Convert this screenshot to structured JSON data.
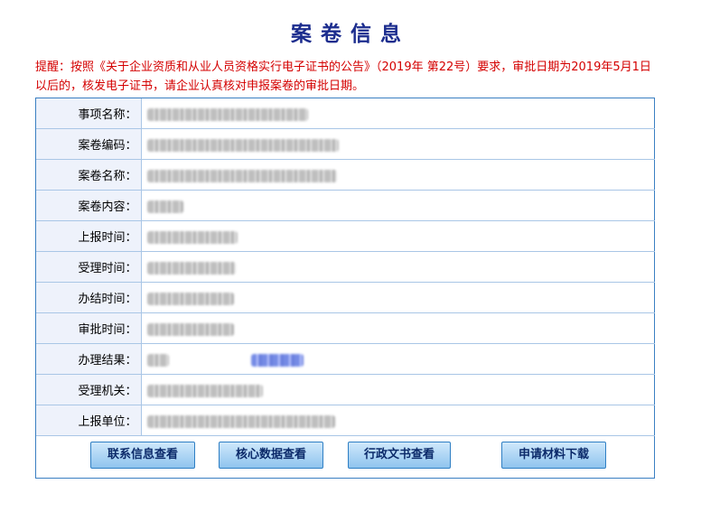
{
  "page": {
    "title": "案卷信息",
    "notice": "提醒：按照《关于企业资质和从业人员资格实行电子证书的公告》（2019年 第22号）要求，审批日期为2019年5月1日以后的，核发电子证书，请企业认真核对申报案卷的审批日期。"
  },
  "fields": [
    {
      "label": "事项名称：",
      "value": "",
      "redacted": true
    },
    {
      "label": "案卷编码：",
      "value": "",
      "redacted": true
    },
    {
      "label": "案卷名称：",
      "value": "",
      "redacted": true
    },
    {
      "label": "案卷内容：",
      "value": "",
      "redacted": true
    },
    {
      "label": "上报时间：",
      "value": "",
      "redacted": true
    },
    {
      "label": "受理时间：",
      "value": "",
      "redacted": true
    },
    {
      "label": "办结时间：",
      "value": "",
      "redacted": true
    },
    {
      "label": "审批时间：",
      "value": "",
      "redacted": true
    },
    {
      "label": "办理结果：",
      "value": "",
      "redacted": true,
      "link_redacted": true
    },
    {
      "label": "受理机关：",
      "value": "",
      "redacted": true
    },
    {
      "label": "上报单位：",
      "value": "",
      "redacted": true
    }
  ],
  "buttons": {
    "contact": "联系信息查看",
    "core": "核心数据查看",
    "document": "行政文书查看",
    "download": "申请材料下载"
  },
  "colors": {
    "title": "#1c2d8e",
    "notice": "#d40000",
    "border": "#3a7fc2",
    "label_bg": "#eef2fb"
  }
}
